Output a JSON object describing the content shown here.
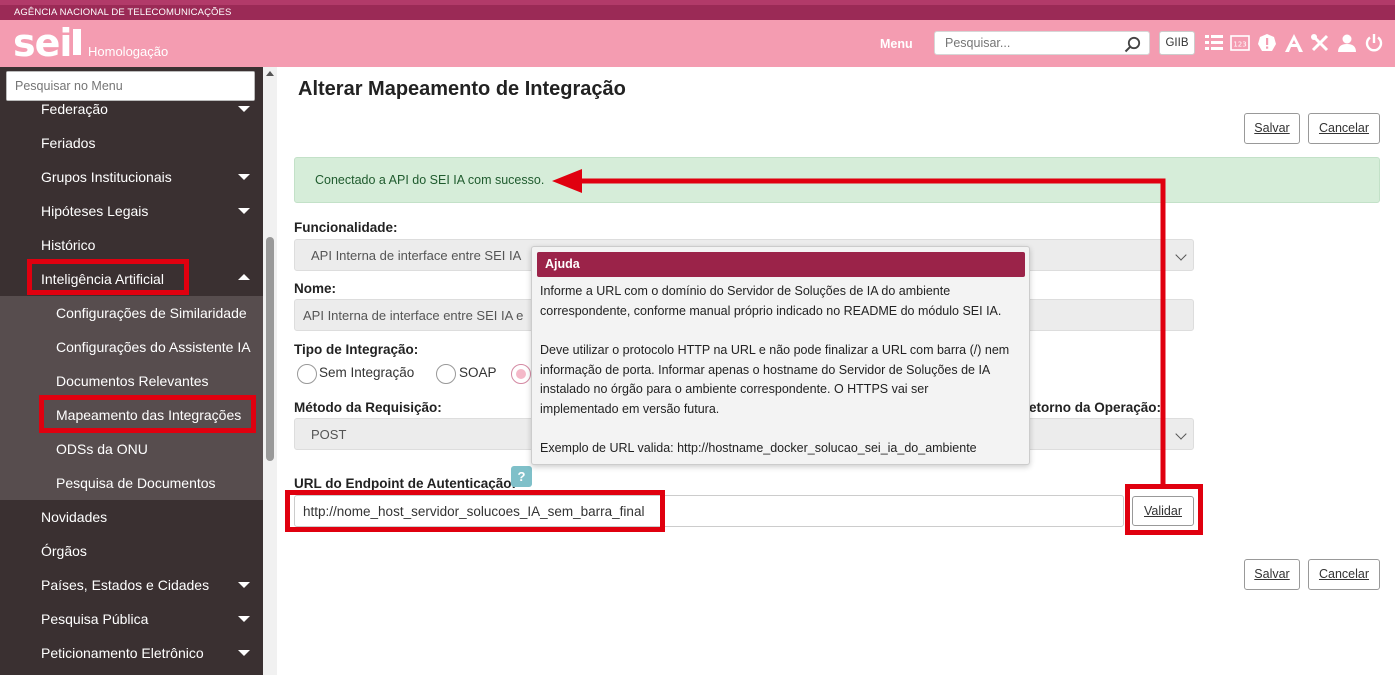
{
  "header": {
    "agency": "AGÊNCIA NACIONAL DE TELECOMUNICAÇÕES",
    "logo": "sei",
    "environment": "Homologação",
    "menu_label": "Menu",
    "search_placeholder": "Pesquisar...",
    "unit": "GIIB",
    "icons": [
      "search-icon",
      "list-icon",
      "numbers-icon",
      "alert-icon",
      "accessibility-icon",
      "tools-icon",
      "user-icon",
      "power-icon"
    ]
  },
  "sidebar": {
    "search_placeholder": "Pesquisar no Menu",
    "items": [
      {
        "label": "Federação",
        "caret": "down"
      },
      {
        "label": "Feriados",
        "caret": ""
      },
      {
        "label": "Grupos Institucionais",
        "caret": "down"
      },
      {
        "label": "Hipóteses Legais",
        "caret": "down"
      },
      {
        "label": "Histórico",
        "caret": ""
      },
      {
        "label": "Inteligência Artificial",
        "caret": "up"
      },
      {
        "label": "Configurações de Similaridade",
        "caret": ""
      },
      {
        "label": "Configurações do Assistente IA",
        "caret": ""
      },
      {
        "label": "Documentos Relevantes",
        "caret": ""
      },
      {
        "label": "Mapeamento das Integrações",
        "caret": ""
      },
      {
        "label": "ODSs da ONU",
        "caret": ""
      },
      {
        "label": "Pesquisa de Documentos",
        "caret": ""
      },
      {
        "label": "Novidades",
        "caret": ""
      },
      {
        "label": "Órgãos",
        "caret": ""
      },
      {
        "label": "Países, Estados e Cidades",
        "caret": "down"
      },
      {
        "label": "Pesquisa Pública",
        "caret": "down"
      },
      {
        "label": "Peticionamento Eletrônico",
        "caret": "down"
      }
    ]
  },
  "main": {
    "title": "Alterar Mapeamento de Integração",
    "save_label": "Salvar",
    "cancel_label": "Cancelar",
    "alert": "Conectado a API do SEI IA com sucesso.",
    "funcionalidade_label": "Funcionalidade:",
    "funcionalidade_value": "API Interna de interface entre SEI IA",
    "nome_label": "Nome:",
    "nome_value": "API Interna de interface entre SEI IA e",
    "tipo_label": "Tipo de Integração:",
    "tipo_options": [
      "Sem Integração",
      "SOAP"
    ],
    "metodo_label": "Método da Requisição:",
    "metodo_value": "POST",
    "retorno_label": "etorno da Operação:",
    "url_label": "URL do Endpoint de Autenticação:",
    "url_value": "http://nome_host_servidor_solucoes_IA_sem_barra_final",
    "help_badge": "?",
    "validar_label": "Validar"
  },
  "tooltip": {
    "title": "Ajuda",
    "lines": [
      "Informe a URL com o domínio do Servidor de Soluções de IA do ambiente",
      "correspondente, conforme manual próprio indicado no README do módulo SEI IA.",
      "",
      "Deve utilizar o protocolo HTTP na URL e não pode finalizar a URL com barra (/) nem",
      "informação de porta. Informar apenas o hostname do Servidor de Soluções de IA",
      "instalado no órgão para o ambiente correspondente. O HTTPS vai ser",
      "implementado em versão futura.",
      "",
      "Exemplo de URL valida: http://hostname_docker_solucao_sei_ia_do_ambiente"
    ]
  },
  "colors": {
    "brand_dark": "#9b2a56",
    "header_pink": "#f49cb1",
    "annotation_red": "#e0000f",
    "success_bg": "#d6edd9"
  }
}
